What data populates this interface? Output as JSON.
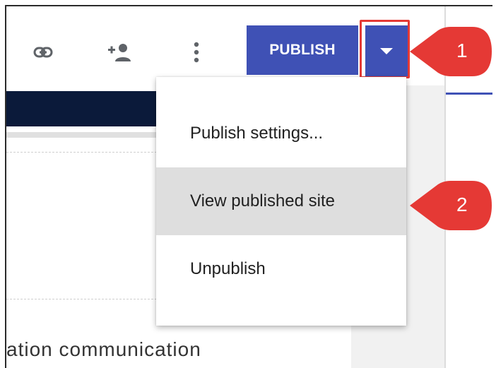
{
  "toolbar": {
    "icons": [
      "link-icon",
      "add-person-icon",
      "more-vert-icon"
    ],
    "publish_label": "PUBLISH",
    "publish_arrow_icon": "dropdown-triangle-icon"
  },
  "menu": {
    "items": [
      {
        "label": "Publish settings...",
        "active": false
      },
      {
        "label": "View published site",
        "active": true
      },
      {
        "label": "Unpublish",
        "active": false
      }
    ]
  },
  "page": {
    "bottom_text": "ation communication"
  },
  "callouts": [
    {
      "number": "1"
    },
    {
      "number": "2"
    }
  ],
  "colors": {
    "accent": "#3f51b5",
    "callout": "#e53935",
    "navy": "#0b1a3a",
    "menu_active": "#dedede"
  }
}
